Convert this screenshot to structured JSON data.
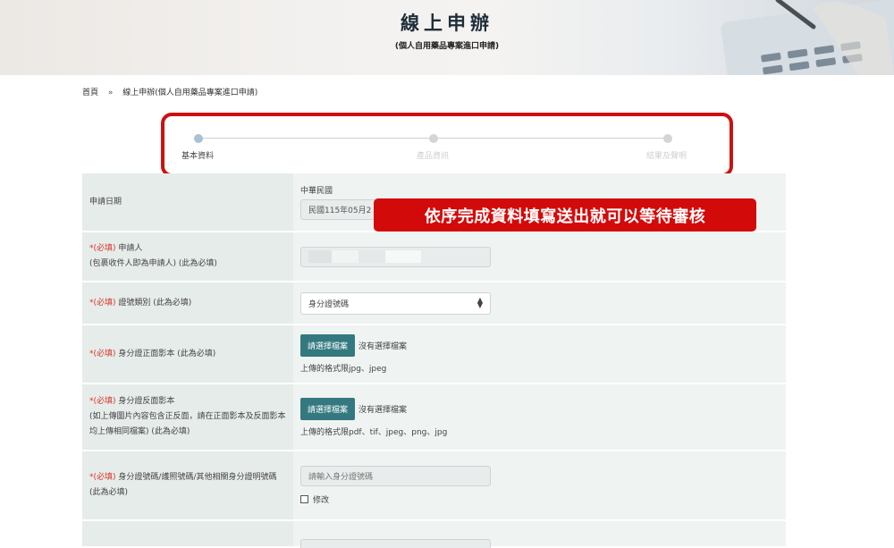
{
  "banner": {
    "title": "線上申辦",
    "subtitle": "(個人自用藥品專案進口申請)"
  },
  "breadcrumb": {
    "home": "首頁",
    "separator": "»",
    "current": "線上申辦(個人自用藥品專案進口申請)"
  },
  "stepper": {
    "steps": [
      {
        "label": "基本資料",
        "active": true
      },
      {
        "label": "產品資訊",
        "active": false
      },
      {
        "label": "結果及聲明",
        "active": false
      }
    ]
  },
  "callout": "依序完成資料填寫送出就可以等待審核",
  "form": {
    "apply_date": {
      "label": "申請日期",
      "era": "中華民國",
      "value": "民國115年05月2"
    },
    "applicant": {
      "req": "*(必填)",
      "label": "申請人",
      "note": "(包裹收件人即為申請人) (此為必填)"
    },
    "id_type": {
      "req": "*(必填)",
      "label": "證號類別 (此為必填)",
      "selected": "身分證號碼"
    },
    "id_front": {
      "req": "*(必填)",
      "label": "身分證正面影本 (此為必填)",
      "button": "請選擇檔案",
      "no_file": "沒有選擇檔案",
      "hint": "上傳的格式限jpg、jpeg"
    },
    "id_back": {
      "req": "*(必填)",
      "label": "身分證反面影本",
      "note": "(如上傳圖片內容包含正反面，請在正面影本及反面影本均上傳相同檔案) (此為必填)",
      "button": "請選擇檔案",
      "no_file": "沒有選擇檔案",
      "hint": "上傳的格式限pdf、tif、jpeg、png、jpg"
    },
    "id_number": {
      "req": "*(必填)",
      "label": "身分證號碼/護照號碼/其他相關身分證明號碼 (此為必填)",
      "placeholder": "請輸入身分證號碼",
      "checkbox": "修改"
    }
  }
}
